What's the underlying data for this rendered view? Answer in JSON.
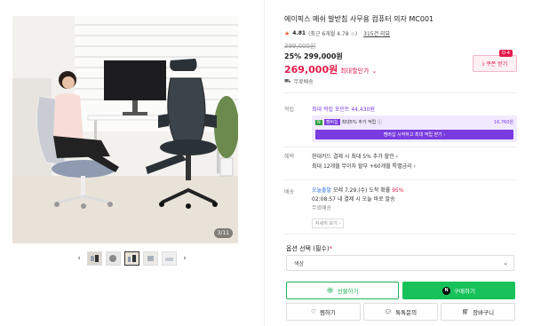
{
  "gallery": {
    "counter": "3/11",
    "prev_arrow": "‹",
    "next_arrow": "›"
  },
  "product": {
    "title": "에이픽스 메쉬 발받침 사무용 컴퓨터 의자 MC001",
    "rating": "4.81",
    "rating_detail": "(최근 6개월 4.78 ☆)",
    "reviews": "315건 리뷰",
    "original_price": "399,000원",
    "discount_percent": "25%",
    "discount_price": "299,000원",
    "sale_price": "269,000원",
    "sale_label": "최대할인가",
    "coupon_label": "쿠폰 받기",
    "coupon_badge": "D-4",
    "shipping": "무료배송"
  },
  "points": {
    "label": "적립",
    "text": "최대 적립 포인트 44,430원",
    "tag1": "N",
    "tag2": "멤버십",
    "bene_text": "최대5% 추가 적립 ⓘ",
    "bene_amount": "16,760원",
    "bene_button": "멤버십 시작하고 최대 적립 받기 ›"
  },
  "benefit": {
    "label": "혜택",
    "line1": "현대카드 결제 시 최대 5% 추가 할인 ›",
    "line2": "최대 12개월 무이자 할부 +60개월 특별금리 ›"
  },
  "delivery": {
    "label": "배송",
    "today": "오늘출발",
    "line1": " 모레 7.29.(수) 도착 확률 ",
    "pct": "95%",
    "line2": "02:08:57 내 결제 시 오늘 바로 발송",
    "line3": "무료배송",
    "detail_link": "자세히 보기 ›"
  },
  "options": {
    "label": "옵션 선택",
    "required": "(필수)",
    "required_mark": "*",
    "select_value": "색상"
  },
  "buttons": {
    "gift": "선물하기",
    "buy": "구매하기",
    "buy_badge": "N",
    "wish": "찜하기",
    "talk": "톡톡문의",
    "cart": "장바구니"
  }
}
